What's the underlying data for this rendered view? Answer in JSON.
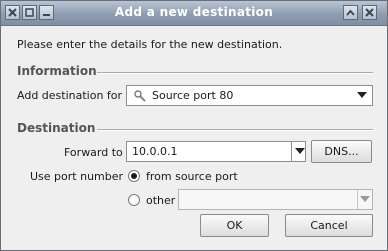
{
  "window": {
    "title": "Add a new destination"
  },
  "message": "Please enter the details for the new destination.",
  "information": {
    "header": "Information",
    "add_for_label": "Add destination for",
    "add_for_value": "Source port 80"
  },
  "destination": {
    "header": "Destination",
    "forward_to_label": "Forward to",
    "forward_to_value": "10.0.0.1",
    "dns_button": "DNS...",
    "use_port_label": "Use port number",
    "option_source": "from source port",
    "option_other": "other",
    "selected_option": "from source port",
    "other_value": ""
  },
  "buttons": {
    "ok": "OK",
    "cancel": "Cancel"
  }
}
